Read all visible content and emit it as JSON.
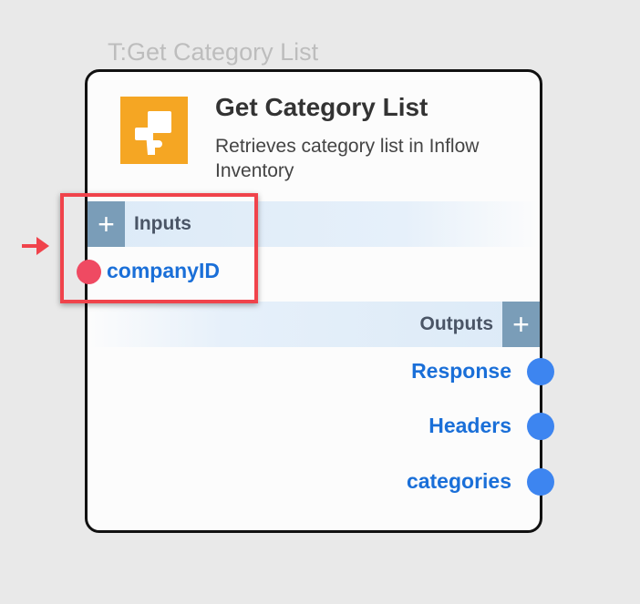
{
  "node": {
    "label": "T:Get Category List",
    "title": "Get Category List",
    "description": "Retrieves category list in Inflow Inventory",
    "icon": "inflow-logo-icon",
    "accent_color": "#f5a623"
  },
  "inputs": {
    "label": "Inputs",
    "add_label": "+",
    "ports": [
      {
        "label": "companyID",
        "color": "#ef4a62"
      }
    ]
  },
  "outputs": {
    "label": "Outputs",
    "add_label": "+",
    "ports": [
      {
        "label": "Response",
        "color": "#3d85f0"
      },
      {
        "label": "Headers",
        "color": "#3d85f0"
      },
      {
        "label": "categories",
        "color": "#3d85f0"
      }
    ]
  },
  "highlight_color": "#f0434b"
}
